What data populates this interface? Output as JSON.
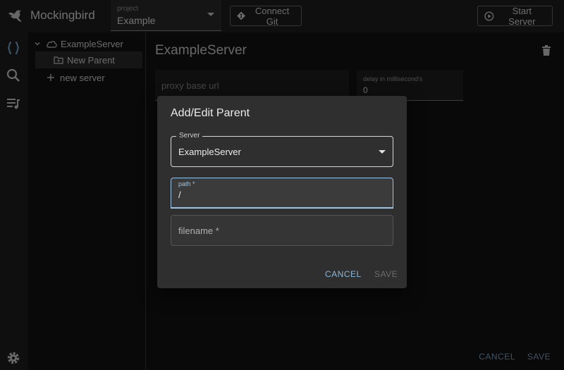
{
  "app": {
    "title": "Mockingbird"
  },
  "project": {
    "label": "project",
    "value": "Example"
  },
  "toolbar": {
    "connect_git": "Connect Git",
    "start_server": "Start Server"
  },
  "tree": {
    "server": "ExampleServer",
    "parent": "New Parent",
    "new_server": "new server"
  },
  "main": {
    "title": "ExampleServer",
    "proxy_placeholder": "proxy base url",
    "delay_label": "delay in millisecond's",
    "delay_value": "0",
    "cancel": "CANCEL",
    "save": "SAVE"
  },
  "dialog": {
    "title": "Add/Edit Parent",
    "server_label": "Server",
    "server_value": "ExampleServer",
    "path_label": "path *",
    "path_value": "/",
    "filename_placeholder": "filename *",
    "cancel": "CANCEL",
    "save": "SAVE"
  },
  "colors": {
    "accent": "#9bc4e6",
    "surface": "#2f2f2f",
    "background": "#121212"
  },
  "icons": [
    "mockingbird-logo-icon",
    "git-icon",
    "play-circle-icon",
    "braces-icon",
    "search-icon",
    "playlist-icon",
    "settings-icon",
    "cloud-icon",
    "folder-icon",
    "plus-icon",
    "trash-icon",
    "chevron-down-icon"
  ]
}
